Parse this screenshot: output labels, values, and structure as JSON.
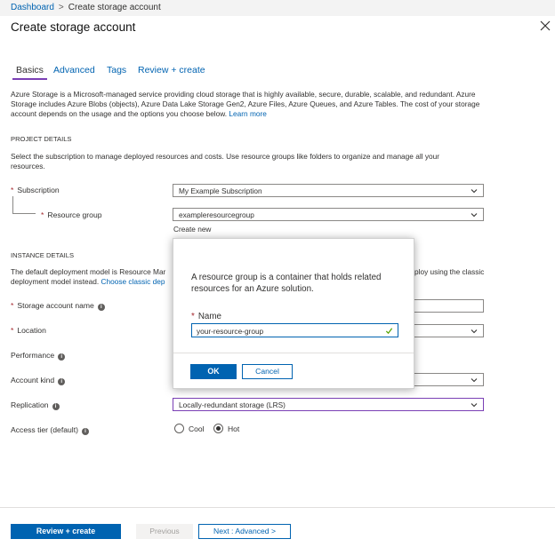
{
  "breadcrumb": {
    "home": "Dashboard",
    "current": "Create storage account",
    "separator": ">"
  },
  "page_title": "Create storage account",
  "tabs": [
    {
      "label": "Basics",
      "active": true
    },
    {
      "label": "Advanced",
      "active": false
    },
    {
      "label": "Tags",
      "active": false
    },
    {
      "label": "Review + create",
      "active": false
    }
  ],
  "intro": {
    "text": "Azure Storage is a Microsoft-managed service providing cloud storage that is highly available, secure, durable, scalable, and redundant. Azure Storage includes Azure Blobs (objects), Azure Data Lake Storage Gen2, Azure Files, Azure Queues, and Azure Tables. The cost of your storage account depends on the usage and the options you choose below.",
    "link": "Learn more"
  },
  "project": {
    "heading": "PROJECT DETAILS",
    "text": "Select the subscription to manage deployed resources and costs. Use resource groups like folders to organize and manage all your resources.",
    "subscription_label": "Subscription",
    "subscription_value": "My Example Subscription",
    "resource_group_label": "Resource group",
    "resource_group_value": "exampleresourcegroup",
    "create_new": "Create new"
  },
  "instance": {
    "heading": "INSTANCE DETAILS",
    "text_left": "The default deployment model is Resource Mar",
    "text_right": "ploy using the classic",
    "text_line2": "deployment model instead.",
    "text_link": "Choose classic dep",
    "storage_name_label": "Storage account name",
    "location_label": "Location",
    "performance_label": "Performance",
    "account_kind_label": "Account kind",
    "replication_label": "Replication",
    "replication_value": "Locally-redundant storage (LRS)",
    "access_tier_label": "Access tier (default)",
    "access_tier_options": [
      "Cool",
      "Hot"
    ],
    "access_tier_selected": "Hot"
  },
  "popup": {
    "text": "A resource group is a container that holds related resources for an Azure solution.",
    "name_label": "Name",
    "name_value": "your-resource-group",
    "ok": "OK",
    "cancel": "Cancel"
  },
  "footer": {
    "review_create": "Review + create",
    "previous": "Previous",
    "next": "Next : Advanced >"
  },
  "colors": {
    "accent": "#0063b1",
    "tab_underline": "#7a3fb5",
    "required": "#a4262c",
    "valid_check": "#57a300"
  }
}
